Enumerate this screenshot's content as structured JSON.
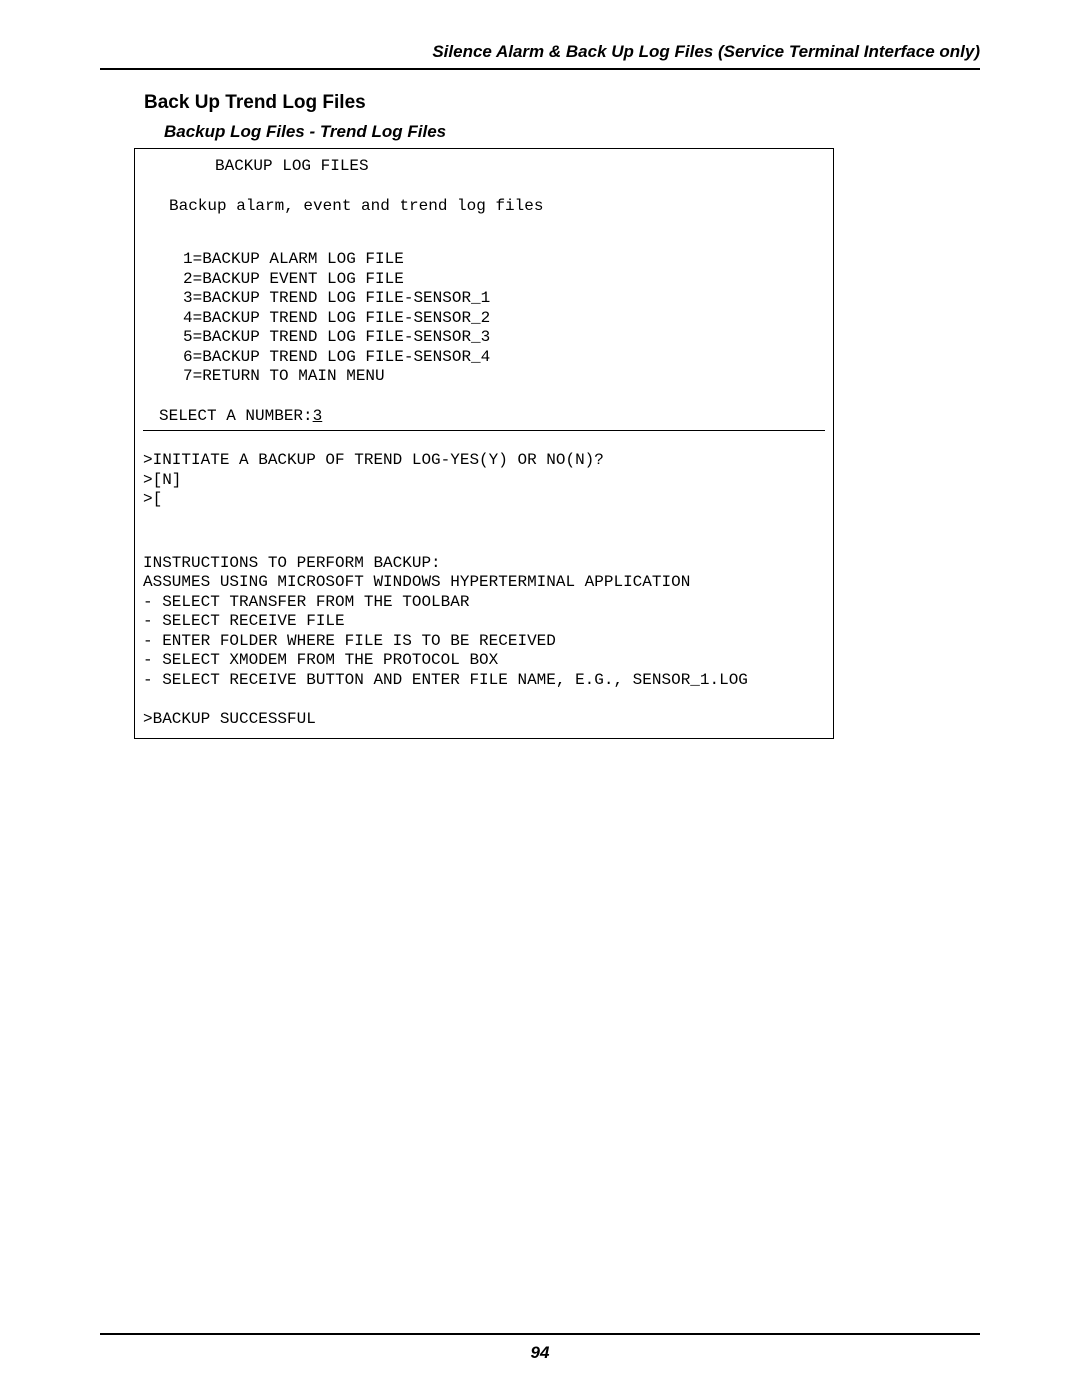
{
  "header": {
    "running_head": "Silence Alarm & Back Up Log Files (Service Terminal Interface only)"
  },
  "section": {
    "heading": "Back Up Trend Log Files",
    "subheading": "Backup Log Files - Trend Log Files"
  },
  "terminal": {
    "title": "BACKUP LOG FILES",
    "desc": "Backup alarm, event and trend log files",
    "options": [
      "1=BACKUP ALARM LOG FILE",
      "2=BACKUP EVENT LOG FILE",
      "3=BACKUP TREND LOG FILE-SENSOR_1",
      "4=BACKUP TREND LOG FILE-SENSOR_2",
      "5=BACKUP TREND LOG FILE-SENSOR_3",
      "6=BACKUP TREND LOG FILE-SENSOR_4",
      "7=RETURN TO MAIN MENU"
    ],
    "select_prompt": "SELECT A NUMBER:",
    "select_input": "3",
    "dialog": [
      ">INITIATE A BACKUP OF TREND LOG-YES(Y) OR NO(N)?",
      ">[N]",
      ">["
    ],
    "instructions": [
      "INSTRUCTIONS TO PERFORM BACKUP:",
      "ASSUMES USING MICROSOFT WINDOWS HYPERTERMINAL APPLICATION",
      "- SELECT TRANSFER FROM THE TOOLBAR",
      "- SELECT RECEIVE FILE",
      "- ENTER FOLDER WHERE FILE IS TO BE RECEIVED",
      "- SELECT XMODEM FROM THE PROTOCOL BOX",
      "- SELECT RECEIVE BUTTON AND ENTER FILE NAME, E.G., SENSOR_1.LOG"
    ],
    "result": ">BACKUP SUCCESSFUL"
  },
  "footer": {
    "page_number": "94"
  }
}
